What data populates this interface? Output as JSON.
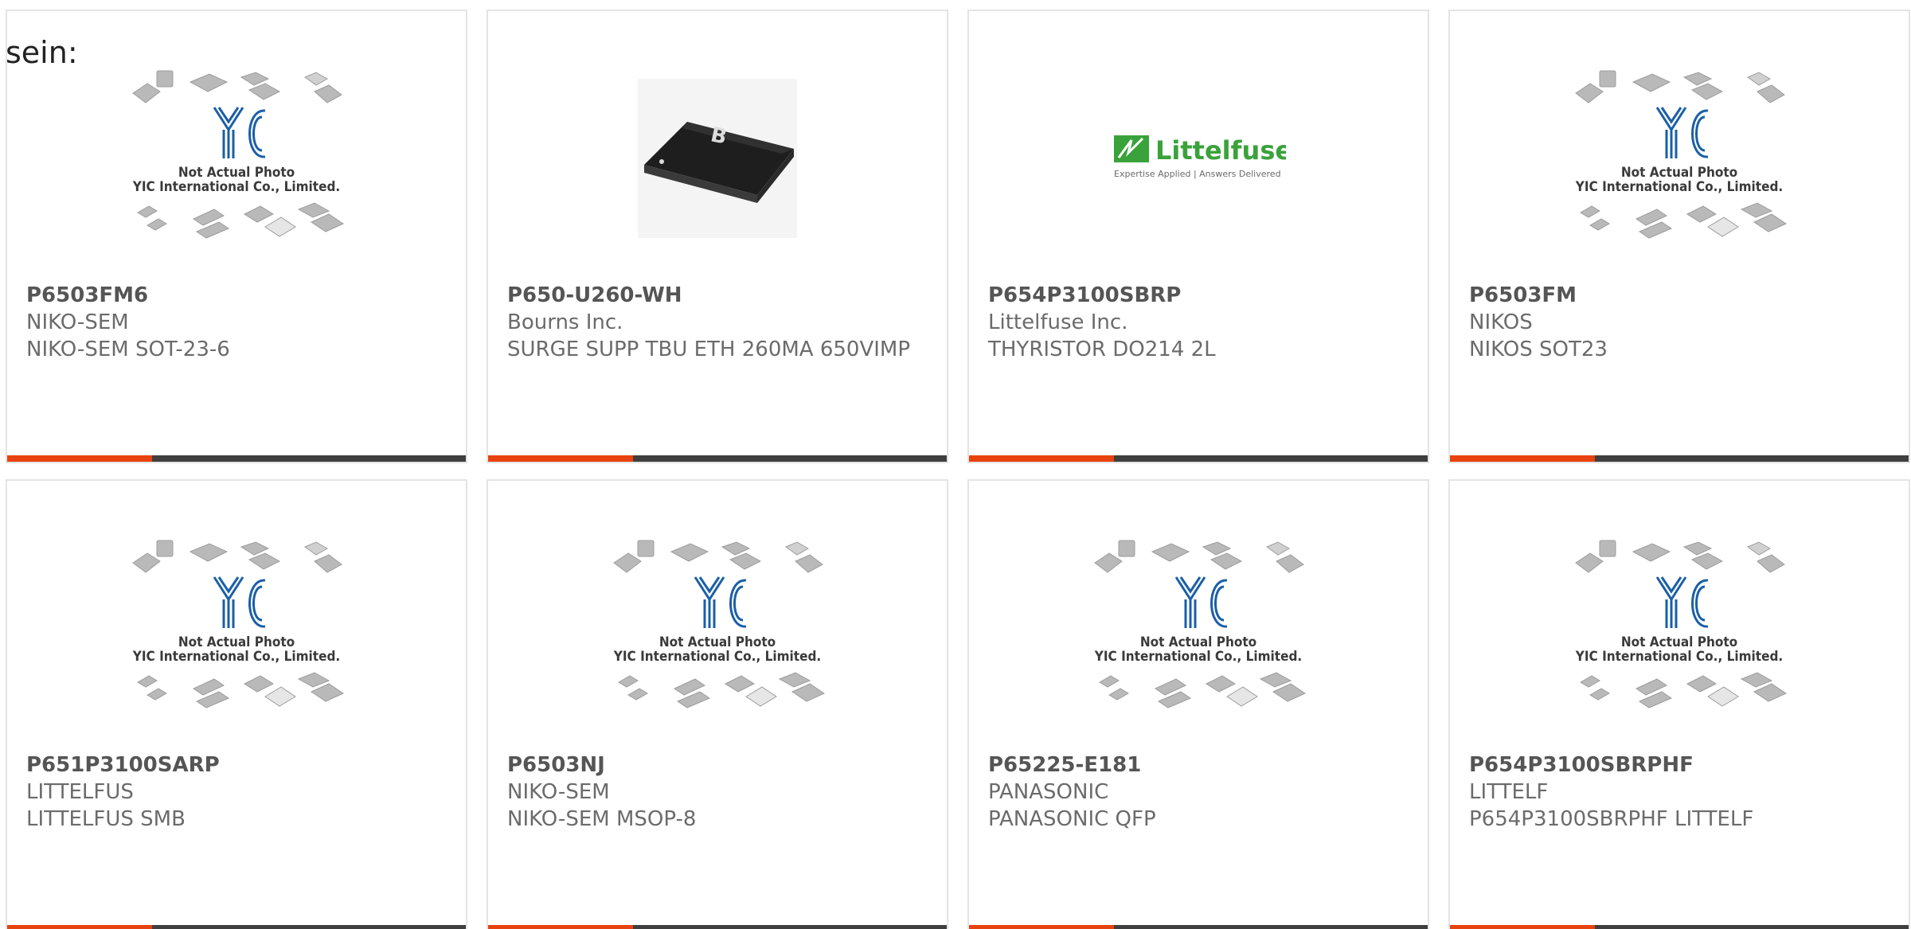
{
  "prefix_text": "sein:",
  "colors": {
    "accent": "#e8420e",
    "bar": "#3f3f3f",
    "yic_blue": "#1a5fa8",
    "littelfuse_green": "#3aa23a"
  },
  "placeholder": {
    "caption_line1": "Not Actual Photo",
    "caption_line2": "YIC International Co., Limited."
  },
  "littelfuse_logo": {
    "brand": "Littelfuse",
    "tagline": "Expertise Applied | Answers Delivered"
  },
  "products": [
    {
      "part_number": "P6503FM6",
      "manufacturer": "NIKO-SEM",
      "description": "NIKO-SEM SOT-23-6",
      "image": "yic-placeholder"
    },
    {
      "part_number": "P650-U260-WH",
      "manufacturer": "Bourns Inc.",
      "description": "SURGE SUPP TBU ETH 260MA 650VIMP",
      "image": "bourns-chip-photo"
    },
    {
      "part_number": "P654P3100SBRP",
      "manufacturer": "Littelfuse Inc.",
      "description": "THYRISTOR DO214 2L",
      "image": "littelfuse-logo"
    },
    {
      "part_number": "P6503FM",
      "manufacturer": "NIKOS",
      "description": "NIKOS SOT23",
      "image": "yic-placeholder"
    },
    {
      "part_number": "P651P3100SARP",
      "manufacturer": "LITTELFUS",
      "description": "LITTELFUS SMB",
      "image": "yic-placeholder"
    },
    {
      "part_number": "P6503NJ",
      "manufacturer": "NIKO-SEM",
      "description": "NIKO-SEM MSOP-8",
      "image": "yic-placeholder"
    },
    {
      "part_number": "P65225-E181",
      "manufacturer": "PANASONIC",
      "description": "PANASONIC QFP",
      "image": "yic-placeholder"
    },
    {
      "part_number": "P654P3100SBRPHF",
      "manufacturer": "LITTELF",
      "description": "P654P3100SBRPHF LITTELF",
      "image": "yic-placeholder"
    }
  ]
}
